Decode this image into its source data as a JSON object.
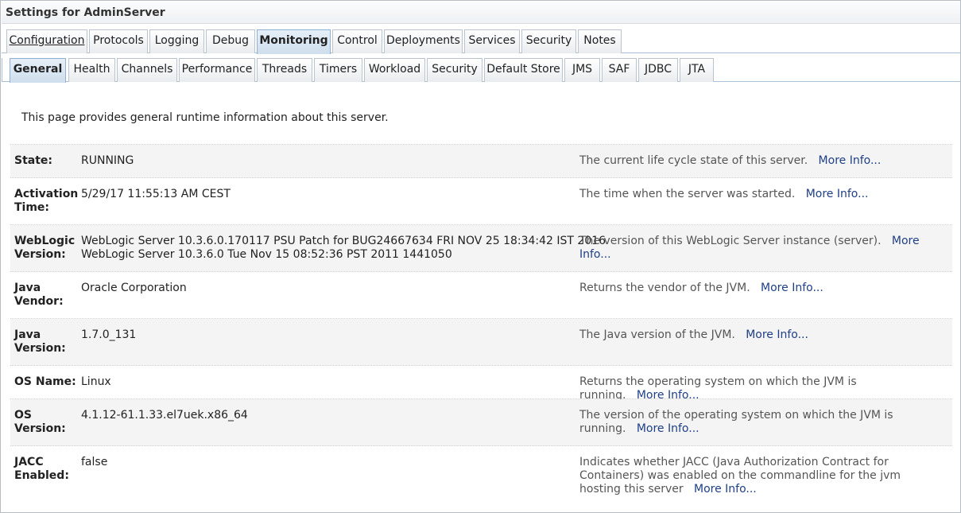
{
  "title": "Settings for AdminServer",
  "tabs": [
    "Configuration",
    "Protocols",
    "Logging",
    "Debug",
    "Monitoring",
    "Control",
    "Deployments",
    "Services",
    "Security",
    "Notes"
  ],
  "subtabs": [
    "General",
    "Health",
    "Channels",
    "Performance",
    "Threads",
    "Timers",
    "Workload",
    "Security",
    "Default Store",
    "JMS",
    "SAF",
    "JDBC",
    "JTA"
  ],
  "selected_tab": "Monitoring",
  "selected_subtab": "General",
  "intro": "This page provides general runtime information about this server.",
  "more_info": "More Info...",
  "rows": [
    {
      "label": "State:",
      "value": "RUNNING",
      "desc": "The current life cycle state of this server."
    },
    {
      "label": "Activation Time:",
      "value": "5/29/17 11:55:13 AM CEST",
      "desc": "The time when the server was started."
    },
    {
      "label": "WebLogic Version:",
      "value": "WebLogic Server 10.3.6.0.170117 PSU Patch for BUG24667634 FRI NOV 25 18:34:42 IST 2016",
      "value2": "WebLogic Server 10.3.6.0 Tue Nov 15 08:52:36 PST 2011 1441050",
      "desc": "The version of this WebLogic Server instance (server)."
    },
    {
      "label": "Java Vendor:",
      "value": "Oracle Corporation",
      "desc": "Returns the vendor of the JVM."
    },
    {
      "label": "Java Version:",
      "value": "1.7.0_131",
      "desc": "The Java version of the JVM."
    },
    {
      "label": "OS Name:",
      "value": "Linux",
      "desc": "Returns the operating system on which the JVM is running."
    },
    {
      "label": "OS Version:",
      "value": "4.1.12-61.1.33.el7uek.x86_64",
      "desc": "The version of the operating system on which the JVM is running."
    },
    {
      "label": "JACC Enabled:",
      "value": "false",
      "desc": "Indicates whether JACC (Java Authorization Contract for Containers) was enabled on the commandline for the jvm hosting this server"
    }
  ]
}
